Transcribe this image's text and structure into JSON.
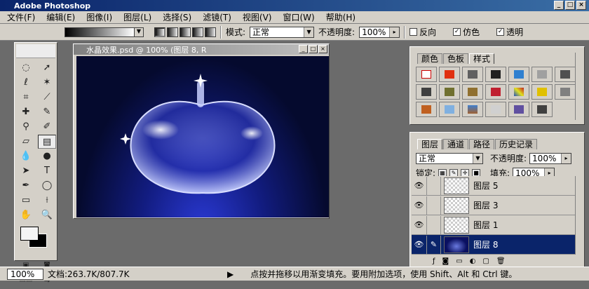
{
  "app": {
    "title": "Adobe Photoshop"
  },
  "menus": [
    "文件(F)",
    "编辑(E)",
    "图像(I)",
    "图层(L)",
    "选择(S)",
    "滤镜(T)",
    "视图(V)",
    "窗口(W)",
    "帮助(H)"
  ],
  "options": {
    "mode_label": "模式:",
    "mode_value": "正常",
    "opacity_label": "不透明度:",
    "opacity_value": "100%",
    "reverse_label": "反向",
    "dither_label": "仿色",
    "transparency_label": "透明"
  },
  "document": {
    "title": "水晶效果.psd @ 100% (图层 8, R"
  },
  "swatch_panel": {
    "tabs": [
      "颜色",
      "色板",
      "样式"
    ]
  },
  "layers_panel": {
    "tabs": [
      "图层",
      "通道",
      "路径",
      "历史记录"
    ],
    "blend_mode": "正常",
    "opacity_label": "不透明度:",
    "opacity_value": "100%",
    "lock_label": "锁定:",
    "fill_label": "填充:",
    "fill_value": "100%",
    "layers": [
      {
        "name": "图层 5"
      },
      {
        "name": "图层 3"
      },
      {
        "name": "图层 1"
      },
      {
        "name": "图层 8"
      }
    ]
  },
  "status": {
    "zoom": "100%",
    "doc_info": "文档:263.7K/807.7K",
    "hint": "点按并拖移以用渐变填充。要用附加选项，使用 Shift、Alt 和 Ctrl 键。"
  }
}
